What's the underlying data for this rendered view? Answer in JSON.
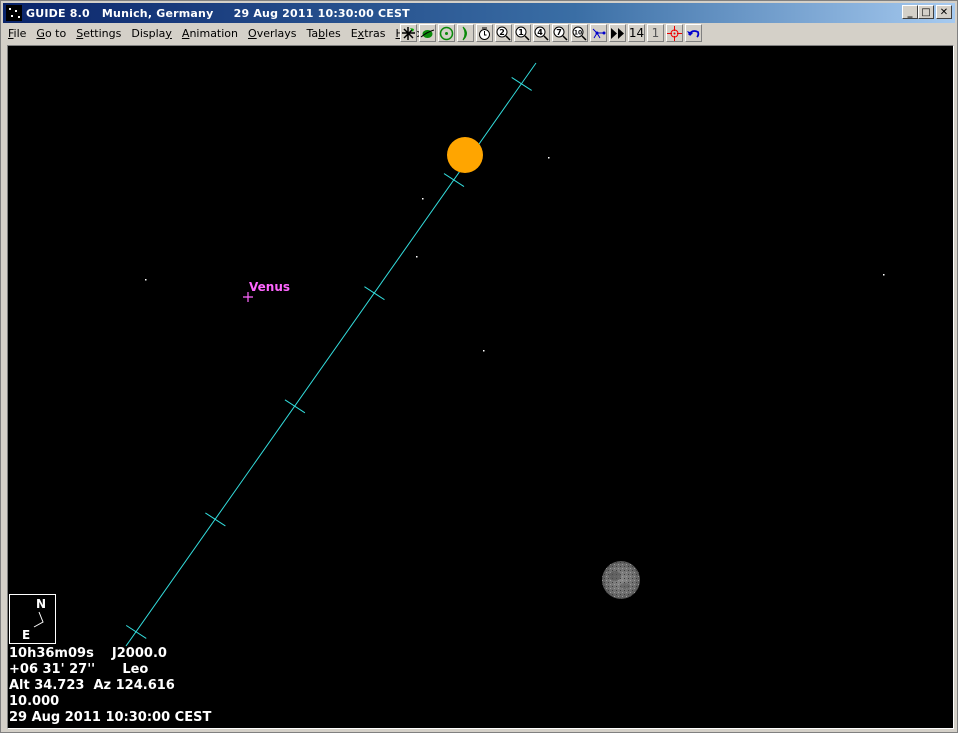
{
  "window": {
    "title": "GUIDE 8.0   Munich, Germany     29 Aug 2011 10:30:00 CEST",
    "buttons": {
      "minimize": "_",
      "maximize": "□",
      "close": "✕"
    }
  },
  "menu": [
    {
      "label": "File",
      "mnemonic": "F"
    },
    {
      "label": "Go to",
      "mnemonic": "G"
    },
    {
      "label": "Settings",
      "mnemonic": "S"
    },
    {
      "label": "Display",
      "mnemonic": "y"
    },
    {
      "label": "Animation",
      "mnemonic": "A"
    },
    {
      "label": "Overlays",
      "mnemonic": "O"
    },
    {
      "label": "Tables",
      "mnemonic": "b"
    },
    {
      "label": "Extras",
      "mnemonic": "x"
    },
    {
      "label": "Help",
      "mnemonic": "H"
    }
  ],
  "toolbar": [
    {
      "name": "star-chart-icon"
    },
    {
      "name": "planet-icon"
    },
    {
      "name": "sun-icon"
    },
    {
      "name": "moon-icon"
    },
    {
      "name": "clock-icon"
    },
    {
      "name": "zoom-2-icon",
      "label": "2"
    },
    {
      "name": "zoom-1-icon",
      "label": "1"
    },
    {
      "name": "zoom-4-icon",
      "label": "4"
    },
    {
      "name": "zoom-7-icon",
      "label": "7"
    },
    {
      "name": "zoom-10-icon",
      "label": "10"
    },
    {
      "name": "constellation-icon"
    },
    {
      "name": "fast-forward-icon"
    },
    {
      "name": "step-14-icon",
      "label": "14"
    },
    {
      "name": "step-1-icon",
      "label": "1"
    },
    {
      "name": "crosshair-icon"
    },
    {
      "name": "undo-icon"
    }
  ],
  "colors": {
    "sky": "#000000",
    "ecliptic": "#33dddd",
    "sun": "#ffa500",
    "venus": "#ff66ff",
    "moon": "#7a7a7a",
    "text": "#ffffff"
  },
  "sky": {
    "objects": {
      "sun": {
        "label": "Sun"
      },
      "venus": {
        "label": "Venus"
      },
      "moon": {
        "label": "Moon"
      }
    },
    "compass": {
      "north": "N",
      "east": "E"
    }
  },
  "info": {
    "ra": "10h36m09s",
    "epoch": "J2000.0",
    "dec": "+06 31' 27''",
    "constellation": "Leo",
    "altaz": "Alt 34.723  Az 124.616",
    "field": "10.000",
    "datetime": "29 Aug 2011 10:30:00 CEST"
  }
}
